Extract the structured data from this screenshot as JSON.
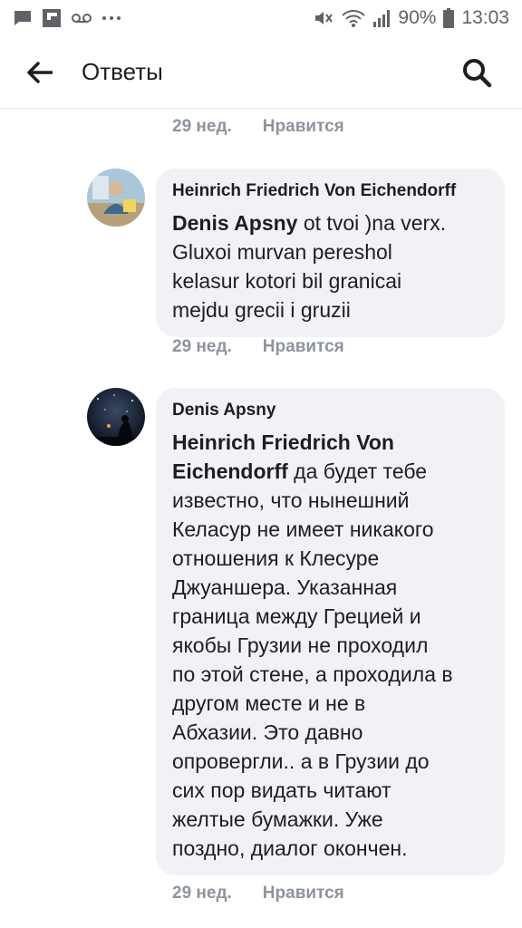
{
  "status_bar": {
    "battery": "90%",
    "time": "13:03",
    "icons": [
      "chat-icon",
      "flipboard-icon",
      "voicemail-icon",
      "more-dots-icon",
      "mute-icon",
      "wifi-icon",
      "signal-icon",
      "battery-icon"
    ]
  },
  "header": {
    "title": "Ответы",
    "icons": [
      "back-arrow-icon",
      "search-icon"
    ]
  },
  "comments": [
    {
      "time": "29 нед.",
      "like_label": "Нравится"
    },
    {
      "author": "Heinrich Friedrich Von Eichendorff",
      "mention": "Denis Apsny",
      "text": " ot tvoi )na verx.\nGluxoi murvan pereshol\nkelasur kotori bil granicai\nmejdu grecii i gruzii",
      "time": "29 нед.",
      "like_label": "Нравится"
    },
    {
      "author": "Denis Apsny",
      "mention": "Heinrich Friedrich Von\nEichendorff",
      "text": " да будет тебе\nизвестно, что нынешний\nКеласур не имеет никакого\nотношения к Клесуре\nДжуаншера. Указанная\nграница между Грецией и\nякобы Грузии не проходил\nпо этой стене, а проходила в\nдругом месте и не в\nАбхазии. Это давно\nопровергли.. а в Грузии до\nсих пор видать читают\nжелтые бумажки.  Уже\nпоздно, диалог окончен.",
      "time": "29 нед.",
      "like_label": "Нравится"
    }
  ],
  "colors": {
    "bubble": "#f0f2f5",
    "meta_text": "#8d949e",
    "divider": "#e4e6eb"
  }
}
